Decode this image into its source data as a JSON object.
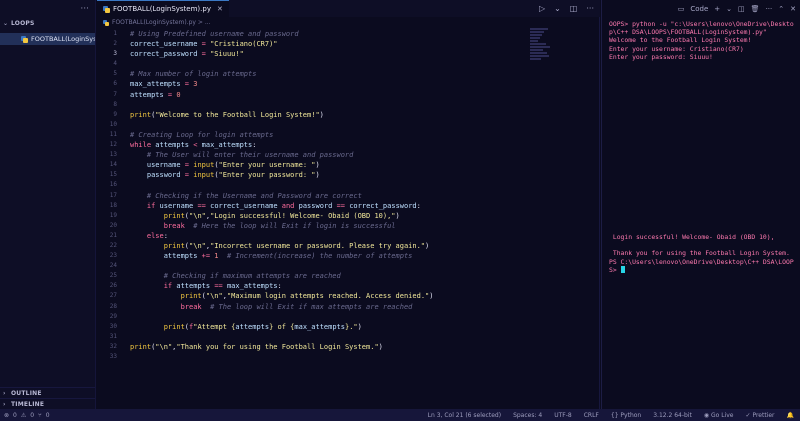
{
  "sidebar": {
    "menu_icon": "more-icon",
    "section_title": "LOOPS",
    "files": [
      {
        "name": "FOOTBALL(LoginSys..."
      }
    ],
    "outline_label": "OUTLINE",
    "timeline_label": "TIMELINE"
  },
  "editor": {
    "tab_label": "FOOTBALL(LoginSystem).py",
    "breadcrumb": "FOOTBALL(LoginSystem).py > ...",
    "line_numbers": [
      "1",
      "2",
      "3",
      "4",
      "5",
      "6",
      "7",
      "8",
      "9",
      "10",
      "11",
      "12",
      "13",
      "14",
      "15",
      "16",
      "17",
      "18",
      "19",
      "20",
      "21",
      "22",
      "23",
      "24",
      "25",
      "26",
      "27",
      "28",
      "29",
      "30",
      "31",
      "32",
      "33"
    ]
  },
  "terminal": {
    "label": "Code",
    "lines": [
      "OOPS> python -u \"c:\\Users\\lenovo\\OneDrive\\Desktop\\C++ DSA\\LOOPS\\FOOTBALL(LoginSystem).py\"",
      "Welcome to the Football Login System!",
      "Enter your username: Cristiano(CR7)",
      "Enter your password: Siuuu!"
    ],
    "lines2": [
      " Login successful! Welcome- Obaid (OBD 10),",
      "",
      " Thank you for using the Football Login System.",
      "PS C:\\Users\\lenovo\\OneDrive\\Desktop\\C++ DSA\\LOOPS>"
    ]
  },
  "status": {
    "errors": "0",
    "warnings": "0",
    "info": "0",
    "position": "Ln 3, Col 21 (6 selected)",
    "spaces": "Spaces: 4",
    "encoding": "UTF-8",
    "eol": "CRLF",
    "language": "Python",
    "interpreter": "3.12.2 64-bit",
    "golive": "Go Live",
    "prettier": "Prettier"
  }
}
